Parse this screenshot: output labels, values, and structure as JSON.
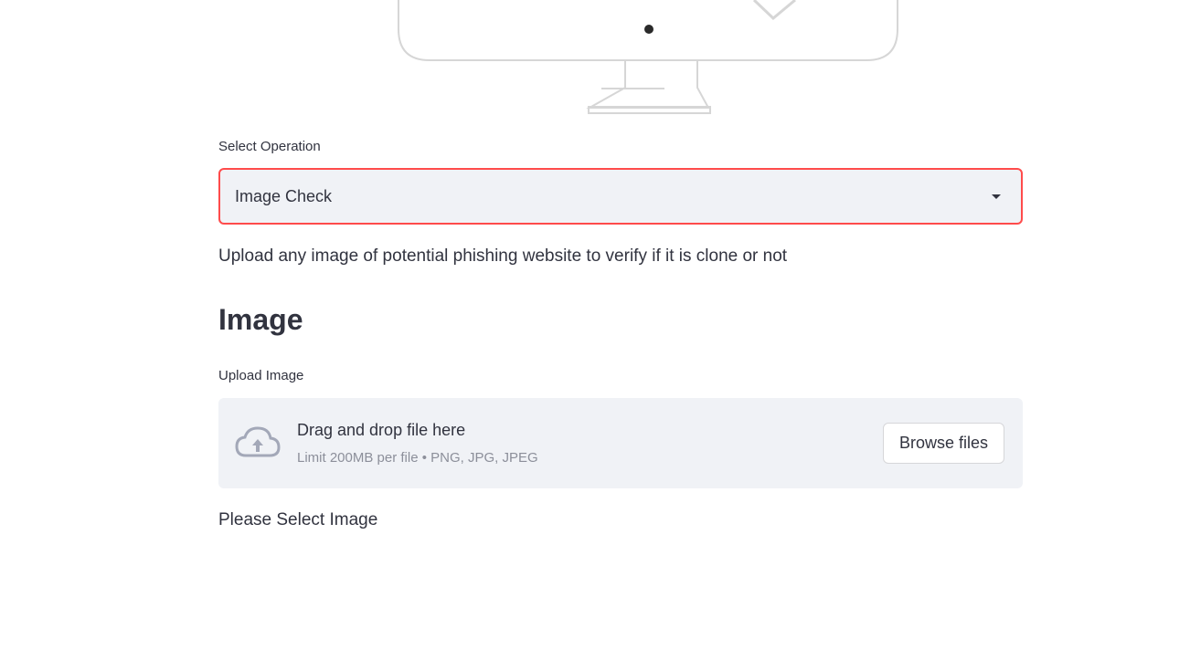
{
  "operation_select": {
    "label": "Select Operation",
    "selected_value": "Image Check"
  },
  "description": "Upload any image of potential phishing website to verify if it is clone or not",
  "section_heading": "Image",
  "uploader": {
    "label": "Upload Image",
    "drop_title": "Drag and drop file here",
    "drop_hint": "Limit 200MB per file • PNG, JPG, JPEG",
    "browse_label": "Browse files",
    "icon": "cloud-upload-icon"
  },
  "status_text": "Please Select Image",
  "colors": {
    "accent": "#ff4b4b",
    "panel_bg": "#f0f2f6",
    "text": "#31333f",
    "muted_text": "#8c8f9a",
    "icon": "#a3a8b8"
  }
}
